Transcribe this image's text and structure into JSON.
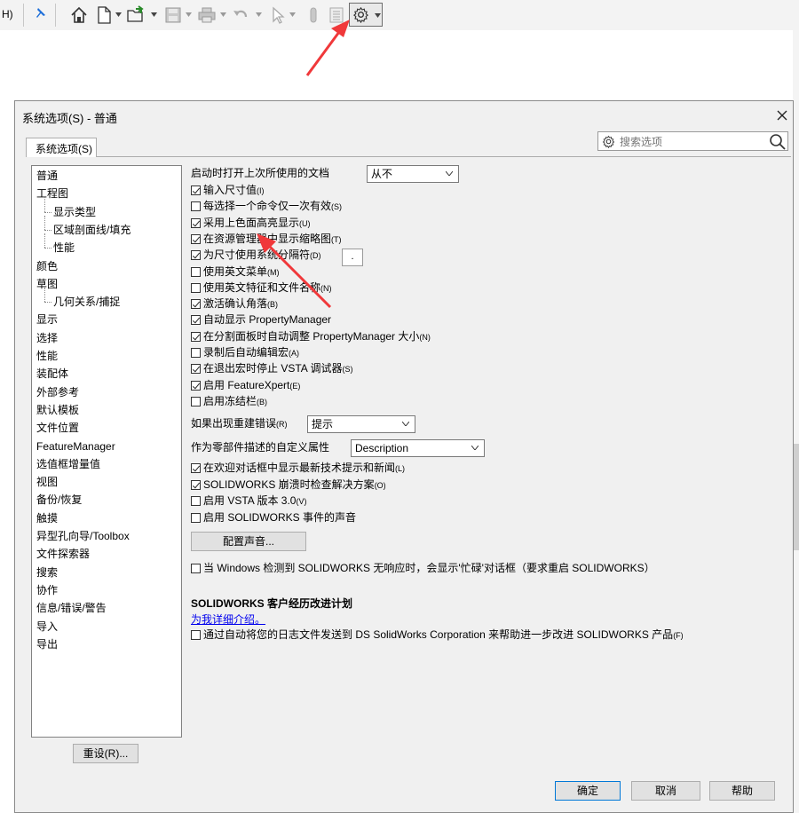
{
  "toolbar": {
    "partial_menu_text": "H)",
    "icons": [
      "pin-icon",
      "home-icon",
      "new-doc-icon",
      "open-icon",
      "save-icon",
      "print-icon",
      "undo-icon",
      "select-icon",
      "rebuild-icon",
      "file-props-icon",
      "options-gear-icon"
    ]
  },
  "dialog": {
    "title": "系统选项(S) - 普通",
    "tab_label": "系统选项(S)",
    "search_placeholder": "搜索选项",
    "reset_button": "重设(R)...",
    "ok_button": "确定",
    "cancel_button": "取消",
    "help_button": "帮助"
  },
  "tree": [
    {
      "label": "普通",
      "level": 0
    },
    {
      "label": "工程图",
      "level": 0
    },
    {
      "label": "显示类型",
      "level": 1
    },
    {
      "label": "区域剖面线/填充",
      "level": 1
    },
    {
      "label": "性能",
      "level": 1
    },
    {
      "label": "颜色",
      "level": 0
    },
    {
      "label": "草图",
      "level": 0
    },
    {
      "label": "几何关系/捕捉",
      "level": 1
    },
    {
      "label": "显示",
      "level": 0
    },
    {
      "label": "选择",
      "level": 0
    },
    {
      "label": "性能",
      "level": 0
    },
    {
      "label": "装配体",
      "level": 0
    },
    {
      "label": "外部参考",
      "level": 0
    },
    {
      "label": "默认模板",
      "level": 0
    },
    {
      "label": "文件位置",
      "level": 0
    },
    {
      "label": "FeatureManager",
      "level": 0
    },
    {
      "label": "选值框增量值",
      "level": 0
    },
    {
      "label": "视图",
      "level": 0
    },
    {
      "label": "备份/恢复",
      "level": 0
    },
    {
      "label": "触摸",
      "level": 0
    },
    {
      "label": "异型孔向导/Toolbox",
      "level": 0
    },
    {
      "label": "文件探索器",
      "level": 0
    },
    {
      "label": "搜索",
      "level": 0
    },
    {
      "label": "协作",
      "level": 0
    },
    {
      "label": "信息/错误/警告",
      "level": 0
    },
    {
      "label": "导入",
      "level": 0
    },
    {
      "label": "导出",
      "level": 0
    }
  ],
  "options": {
    "startup_label": "启动时打开上次所使用的文档",
    "startup_value": "从不",
    "checkboxes": [
      {
        "text": "输入尺寸值",
        "hotkey": "(I)",
        "checked": true
      },
      {
        "text": "每选择一个命令仅一次有效",
        "hotkey": "(S)",
        "checked": false
      },
      {
        "text": "采用上色面高亮显示",
        "hotkey": "(U)",
        "checked": true
      },
      {
        "text": "在资源管理器中显示缩略图",
        "hotkey": "(T)",
        "checked": true
      },
      {
        "text": "为尺寸使用系统分隔符",
        "hotkey": "(D)",
        "checked": true
      },
      {
        "text": "使用英文菜单",
        "hotkey": "(M)",
        "checked": false
      },
      {
        "text": "使用英文特征和文件名称",
        "hotkey": "(N)",
        "checked": false
      },
      {
        "text": "激活确认角落",
        "hotkey": "(B)",
        "checked": true
      },
      {
        "text": "自动显示 PropertyManager",
        "hotkey": "",
        "checked": true
      },
      {
        "text": "在分割面板时自动调整 PropertyManager 大小",
        "hotkey": "(N)",
        "checked": true
      },
      {
        "text": "录制后自动编辑宏",
        "hotkey": "(A)",
        "checked": false
      },
      {
        "text": "在退出宏时停止 VSTA 调试器",
        "hotkey": "(S)",
        "checked": true
      },
      {
        "text": "启用 FeatureXpert",
        "hotkey": "(E)",
        "checked": true
      },
      {
        "text": "启用冻结栏",
        "hotkey": "(B)",
        "checked": false
      }
    ],
    "separator_value": ".",
    "rebuild_error_label": "如果出现重建错误",
    "rebuild_error_hotkey": "(R)",
    "rebuild_error_value": "提示",
    "custom_prop_label": "作为零部件描述的自定义属性",
    "custom_prop_value": "Description",
    "checkboxes2": [
      {
        "text": "在欢迎对话框中显示最新技术提示和新闻",
        "hotkey": "(L)",
        "checked": true
      },
      {
        "text": "SOLIDWORKS 崩溃时检查解决方案",
        "hotkey": "(O)",
        "checked": true
      },
      {
        "text": "启用 VSTA 版本 3.0",
        "hotkey": "(V)",
        "checked": false
      },
      {
        "text": "启用 SOLIDWORKS 事件的声音",
        "hotkey": "",
        "checked": false
      }
    ],
    "config_sound_button": "配置声音...",
    "windows_hang_text": "当 Windows 检测到 SOLIDWORKS 无响应时，会显示'忙碌'对话框（要求重启 SOLIDWORKS）",
    "cep_title": "SOLIDWORKS 客户经历改进计划",
    "cep_link": "为我详细介绍。",
    "cep_checkbox_text": "通过自动将您的日志文件发送到 DS SolidWorks Corporation 来帮助进一步改进 SOLIDWORKS 产品",
    "cep_checkbox_hotkey": "(F)"
  },
  "colors": {
    "arrow": "#f0383a",
    "focus_blue": "#0078d7",
    "link": "#0000ee"
  }
}
